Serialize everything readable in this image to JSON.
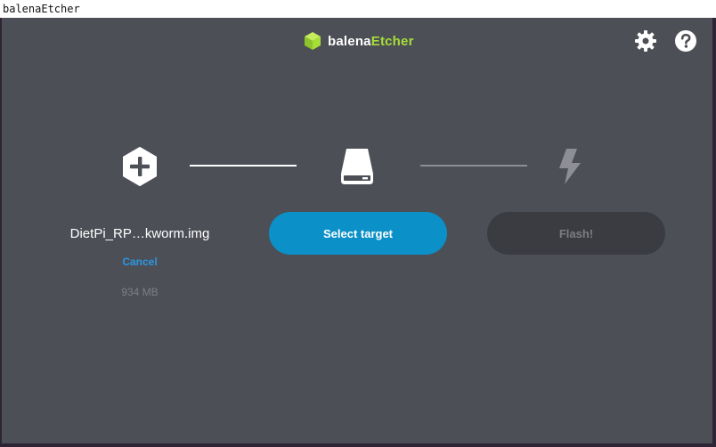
{
  "window": {
    "title": "balenaEtcher"
  },
  "header": {
    "logo_part1": "balena",
    "logo_part2": "Etcher",
    "settings_icon": "gear-icon",
    "help_icon": "question-icon"
  },
  "steps": {
    "image": {
      "icon": "plus-hexagon-icon",
      "filename": "DietPi_RP…kworm.img",
      "cancel_label": "Cancel",
      "size": "934 MB"
    },
    "target": {
      "icon": "drive-icon",
      "button_label": "Select target"
    },
    "flash": {
      "icon": "lightning-icon",
      "button_label": "Flash!",
      "enabled": false
    }
  },
  "colors": {
    "background": "#4d4f57",
    "accent_blue": "#0b90c8",
    "link_blue": "#2997e0",
    "brand_green": "#a5de37"
  }
}
